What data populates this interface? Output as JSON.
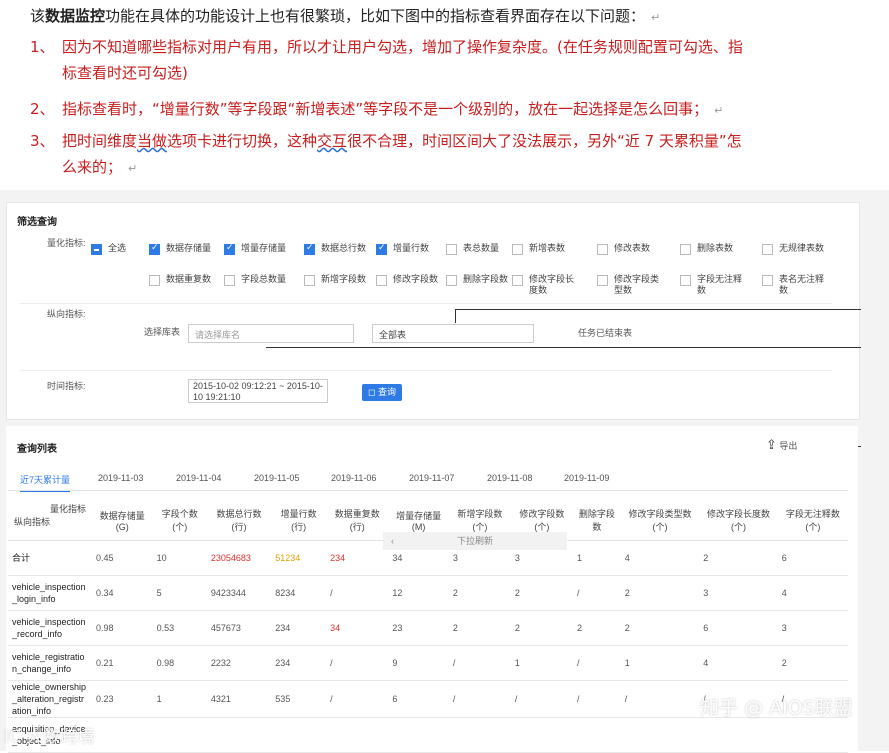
{
  "intro": {
    "prefix": "该",
    "bold": "数据监控",
    "suffix": "功能在具体的功能设计上也有很繁琐，比如下图中的指标查看界面存在以下问题："
  },
  "issues": [
    {
      "num": "1、",
      "line1": "因为不知道哪些指标对用户有用，所以才让用户勾选，增加了操作复杂度。(在任务规则配置可勾选、指",
      "line2": "标查看时还可勾选)"
    },
    {
      "num": "2、",
      "line1": "指标查看时，“增量行数”等字段跟“新增表述”等字段不是一个级别的，放在一起选择是怎么回事；"
    },
    {
      "num": "3、",
      "line1a": "把时间维度",
      "line1u": "当做",
      "line1b": "选项卡进行切换，这种",
      "line1c": "交互",
      "line1d": "很不合理，时间区间大了没法展示，另外“近 7 天累积量”怎",
      "line2": "么来的；"
    }
  ],
  "filter": {
    "title": "筛选查询",
    "metric_label": "量化指标:",
    "checks_row1": [
      {
        "label": "全选",
        "state": "part"
      },
      {
        "label": "数据存储量",
        "state": "on"
      },
      {
        "label": "增量存储量",
        "state": "on"
      },
      {
        "label": "数据总行数",
        "state": "on"
      },
      {
        "label": "增量行数",
        "state": "on"
      },
      {
        "label": "表总数量",
        "state": "off"
      },
      {
        "label": "新增表数",
        "state": "off"
      },
      {
        "label": "修改表数",
        "state": "off"
      },
      {
        "label": "删除表数",
        "state": "off"
      },
      {
        "label": "无规律表数",
        "state": "off"
      }
    ],
    "checks_row2": [
      {
        "label": "数据重复数",
        "state": "off"
      },
      {
        "label": "字段总数量",
        "state": "off"
      },
      {
        "label": "新增字段数",
        "state": "off"
      },
      {
        "label": "修改字段数",
        "state": "off"
      },
      {
        "label": "删除字段数",
        "state": "off"
      },
      {
        "label": "修改字段长度数",
        "state": "off"
      },
      {
        "label": "修改字段类型数",
        "state": "off"
      },
      {
        "label": "字段无注释数",
        "state": "off"
      },
      {
        "label": "表名无注释数",
        "state": "off"
      }
    ],
    "dimension_label": "纵向指标:",
    "db_label": "选择库表",
    "db_placeholder": "请选择库名",
    "table_value": "全部表",
    "task_status": "任务已结束表",
    "time_label": "时间指标:",
    "time_value": "2015-10-02 09:12:21 ~ 2015-10-10 19:21:10",
    "query_button": "◻ 查询"
  },
  "list": {
    "title": "查询列表",
    "export": "导出",
    "tabs": [
      "近7天累计量",
      "2019-11-03",
      "2019-11-04",
      "2019-11-05",
      "2019-11-06",
      "2019-11-07",
      "2019-11-08",
      "2019-11-09"
    ],
    "corner_top": "量化指标",
    "corner_bottom": "纵向指标",
    "headers": [
      "数据存储量(G)",
      "字段个数(个)",
      "数据总行数(行)",
      "增量行数(行)",
      "数据重复数(行)",
      "增量存储量(M)",
      "新增字段数(个)",
      "修改字段数(个)",
      "删除字段数",
      "修改字段类型数(个)",
      "修改字段长度数(个)",
      "字段无注释数(个)"
    ],
    "pull_hint": "下拉刷新",
    "rows": [
      {
        "name": "合计",
        "cells": [
          "0.45",
          "10",
          "23054683",
          "51234",
          "234",
          "34",
          "3",
          "3",
          "1",
          "4",
          "2",
          "6"
        ]
      },
      {
        "name": "vehicle_inspection_login_info",
        "cells": [
          "0.34",
          "5",
          "9423344",
          "8234",
          "/",
          "12",
          "2",
          "2",
          "/",
          "2",
          "3",
          "4"
        ]
      },
      {
        "name": "vehicle_inspection_record_info",
        "cells": [
          "0.98",
          "0.53",
          "457673",
          "234",
          "34",
          "23",
          "2",
          "2",
          "2",
          "2",
          "6",
          "3"
        ]
      },
      {
        "name": "vehicle_registration_change_info",
        "cells": [
          "0.21",
          "0.98",
          "2232",
          "234",
          "/",
          "9",
          "/",
          "1",
          "/",
          "1",
          "4",
          "2"
        ]
      },
      {
        "name": "vehicle_ownership_alteration_registration_info",
        "cells": [
          "0.23",
          "1",
          "4321",
          "535",
          "/",
          "6",
          "/",
          "/",
          "/",
          "/",
          "/",
          "/"
        ]
      },
      {
        "name": "acquisition_device_object_info",
        "cells": [
          "",
          "",
          "",
          "",
          "",
          "",
          "",
          "",
          "",
          "",
          "",
          ""
        ]
      }
    ]
  },
  "watermarks": {
    "left": "IC 大数跨境",
    "right": "知乎 @ AIOS联盟"
  }
}
